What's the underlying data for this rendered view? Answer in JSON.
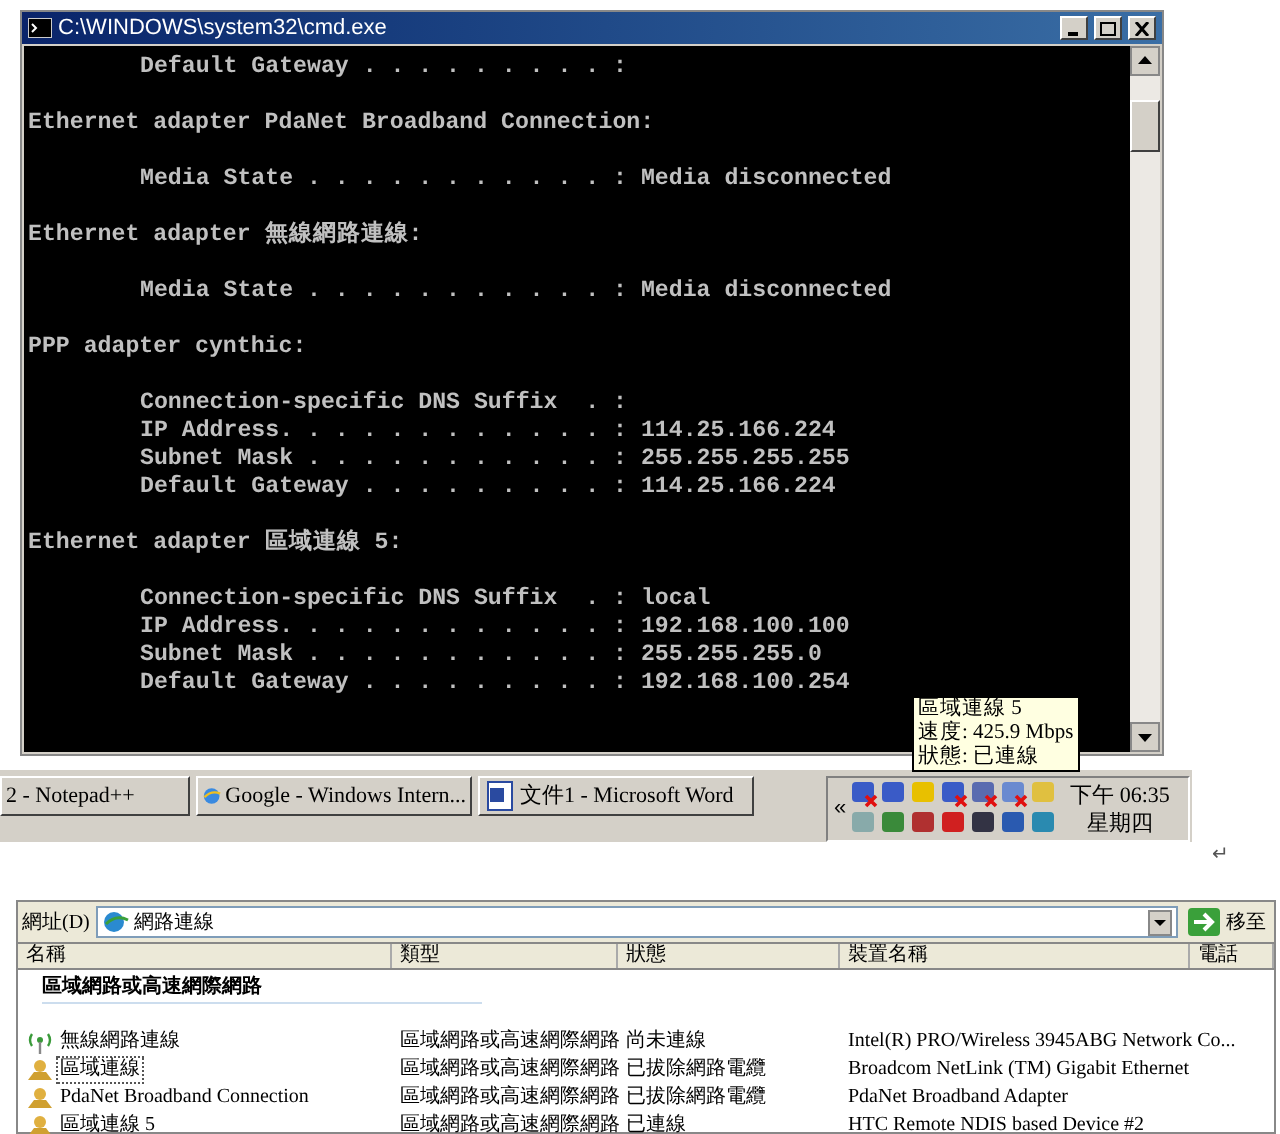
{
  "console_window": {
    "title": "C:\\WINDOWS\\system32\\cmd.exe",
    "lines": [
      {
        "kind": "entry",
        "text": "Default Gateway . . . . . . . . . :"
      },
      {
        "kind": "heading",
        "text": "Ethernet adapter PdaNet Broadband Connection:"
      },
      {
        "kind": "entry",
        "text": "Media State . . . . . . . . . . . : Media disconnected"
      },
      {
        "kind": "heading",
        "text": "Ethernet adapter 無線網路連線:"
      },
      {
        "kind": "entry",
        "text": "Media State . . . . . . . . . . . : Media disconnected"
      },
      {
        "kind": "heading",
        "text": "PPP adapter cynthic:"
      },
      {
        "kind": "entry",
        "text": "Connection-specific DNS Suffix  . :"
      },
      {
        "kind": "entry",
        "text": "IP Address. . . . . . . . . . . . : 114.25.166.224"
      },
      {
        "kind": "entry",
        "text": "Subnet Mask . . . . . . . . . . . : 255.255.255.255"
      },
      {
        "kind": "entry",
        "text": "Default Gateway . . . . . . . . . : 114.25.166.224"
      },
      {
        "kind": "heading",
        "text": "Ethernet adapter 區域連線 5:"
      },
      {
        "kind": "entry",
        "text": "Connection-specific DNS Suffix  . : local"
      },
      {
        "kind": "entry",
        "text": "IP Address. . . . . . . . . . . . : 192.168.100.100"
      },
      {
        "kind": "entry",
        "text": "Subnet Mask . . . . . . . . . . . : 255.255.255.0"
      },
      {
        "kind": "entry",
        "text": "Default Gateway . . . . . . . . . : 192.168.100.254"
      }
    ]
  },
  "tooltip": {
    "lines": [
      "區域連線 5",
      "速度: 425.9 Mbps",
      "狀態: 已連線"
    ]
  },
  "taskbar": {
    "buttons": [
      {
        "kind": "notepad",
        "label": "2 - Notepad++"
      },
      {
        "kind": "browser",
        "label": "Google - Windows Intern..."
      },
      {
        "kind": "word",
        "label": "文件1 - Microsoft Word"
      }
    ],
    "tray_chevron": "«",
    "time": "下午 06:35",
    "day": "星期四"
  },
  "paragraph_mark": "↵",
  "explorer": {
    "address_label": "網址(D)",
    "address": "網路連線",
    "go_button": "移至",
    "columns": [
      "名稱",
      "類型",
      "狀態",
      "裝置名稱",
      "電話"
    ],
    "group": "區域網路或高速網際網路",
    "rows": [
      {
        "kind": "wireless",
        "selected": false,
        "name": "無線網路連線",
        "type": "區域網路或高速網際網路",
        "status": "尚未連線",
        "device": "Intel(R) PRO/Wireless 3945ABG Network Co..."
      },
      {
        "kind": "lan",
        "selected": true,
        "name": "區域連線",
        "type": "區域網路或高速網際網路",
        "status": "已拔除網路電纜",
        "device": "Broadcom NetLink (TM) Gigabit Ethernet"
      },
      {
        "kind": "lan",
        "selected": false,
        "name": "PdaNet Broadband Connection",
        "type": "區域網路或高速網際網路",
        "status": "已拔除網路電纜",
        "device": "PdaNet Broadband Adapter"
      },
      {
        "kind": "lan",
        "selected": false,
        "name": "區域連線 5",
        "type": "區域網路或高速網際網路",
        "status": "已連線",
        "device": "HTC Remote NDIS based Device #2"
      }
    ]
  }
}
